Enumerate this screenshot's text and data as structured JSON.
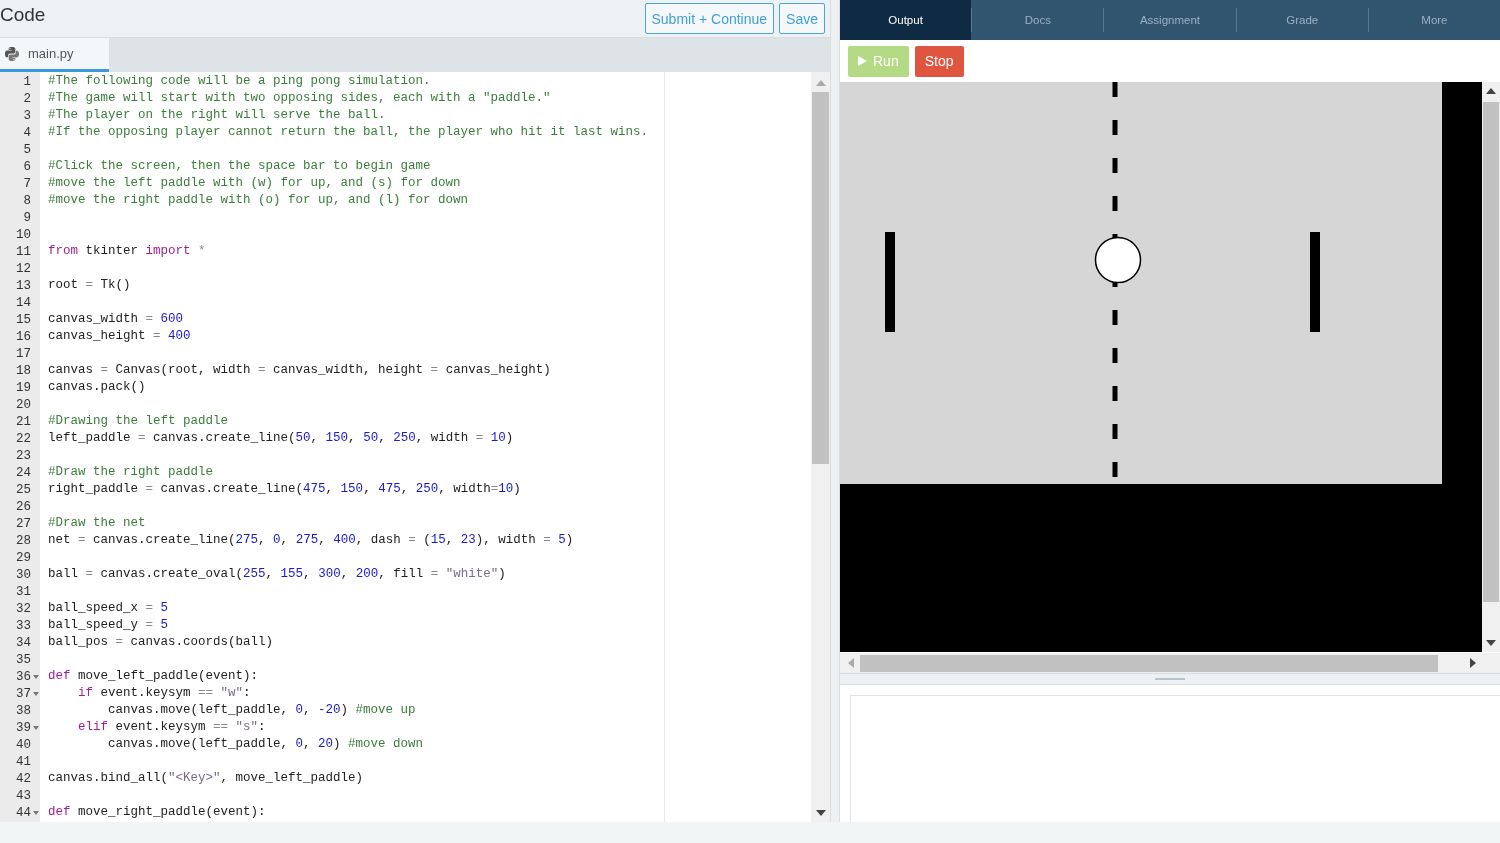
{
  "editor": {
    "title": "Code",
    "buttons": [
      {
        "label": "Submit + Continue"
      },
      {
        "label": "Save"
      }
    ],
    "file_tabs": [
      {
        "label": "main.py",
        "selected": true
      }
    ],
    "lines": [
      {
        "number": "1",
        "fold": false,
        "tokens": [
          {
            "kind": "comment",
            "text": "#The following code will be a ping pong simulation."
          }
        ]
      },
      {
        "number": "2",
        "fold": false,
        "tokens": [
          {
            "kind": "comment",
            "text": "#The game will start with two opposing sides, each with a \"paddle.\""
          }
        ]
      },
      {
        "number": "3",
        "fold": false,
        "tokens": [
          {
            "kind": "comment",
            "text": "#The player on the right will serve the ball."
          }
        ]
      },
      {
        "number": "4",
        "fold": false,
        "tokens": [
          {
            "kind": "comment",
            "text": "#If the opposing player cannot return the ball, the player who hit it last wins."
          }
        ]
      },
      {
        "number": "5",
        "fold": false
      },
      {
        "number": "6",
        "fold": false,
        "tokens": [
          {
            "kind": "comment",
            "text": "#Click the screen, then the space bar to begin game"
          }
        ]
      },
      {
        "number": "7",
        "fold": false,
        "tokens": [
          {
            "kind": "comment",
            "text": "#move the left paddle with (w) for up, and (s) for down"
          }
        ]
      },
      {
        "number": "8",
        "fold": false,
        "tokens": [
          {
            "kind": "comment",
            "text": "#move the right paddle with (o) for up, and (l) for down"
          }
        ]
      },
      {
        "number": "9",
        "fold": false
      },
      {
        "number": "10",
        "fold": false
      },
      {
        "number": "11",
        "fold": false,
        "tokens": [
          {
            "kind": "keyword",
            "text": "from"
          },
          {
            "kind": "plain",
            "text": " tkinter "
          },
          {
            "kind": "keyword",
            "text": "import"
          },
          {
            "kind": "operator",
            "text": " *"
          }
        ]
      },
      {
        "number": "12",
        "fold": false
      },
      {
        "number": "13",
        "fold": false,
        "tokens": [
          {
            "kind": "plain",
            "text": "root "
          },
          {
            "kind": "operator",
            "text": "="
          },
          {
            "kind": "plain",
            "text": " Tk()"
          }
        ]
      },
      {
        "number": "14",
        "fold": false
      },
      {
        "number": "15",
        "fold": false,
        "tokens": [
          {
            "kind": "plain",
            "text": "canvas_width "
          },
          {
            "kind": "operator",
            "text": "= "
          },
          {
            "kind": "number",
            "text": "600"
          }
        ]
      },
      {
        "number": "16",
        "fold": false,
        "tokens": [
          {
            "kind": "plain",
            "text": "canvas_height "
          },
          {
            "kind": "operator",
            "text": "= "
          },
          {
            "kind": "number",
            "text": "400"
          }
        ]
      },
      {
        "number": "17",
        "fold": false
      },
      {
        "number": "18",
        "fold": false,
        "tokens": [
          {
            "kind": "plain",
            "text": "canvas "
          },
          {
            "kind": "operator",
            "text": "="
          },
          {
            "kind": "plain",
            "text": " Canvas(root, width "
          },
          {
            "kind": "operator",
            "text": "="
          },
          {
            "kind": "plain",
            "text": " canvas_width, height "
          },
          {
            "kind": "operator",
            "text": "="
          },
          {
            "kind": "plain",
            "text": " canvas_height)"
          }
        ]
      },
      {
        "number": "19",
        "fold": false,
        "tokens": [
          {
            "kind": "plain",
            "text": "canvas.pack()"
          }
        ]
      },
      {
        "number": "20",
        "fold": false
      },
      {
        "number": "21",
        "fold": false,
        "tokens": [
          {
            "kind": "comment",
            "text": "#Drawing the left paddle"
          }
        ]
      },
      {
        "number": "22",
        "fold": false,
        "tokens": [
          {
            "kind": "plain",
            "text": "left_paddle "
          },
          {
            "kind": "operator",
            "text": "="
          },
          {
            "kind": "plain",
            "text": " canvas.create_line("
          },
          {
            "kind": "number",
            "text": "50"
          },
          {
            "kind": "plain",
            "text": ", "
          },
          {
            "kind": "number",
            "text": "150"
          },
          {
            "kind": "plain",
            "text": ", "
          },
          {
            "kind": "number",
            "text": "50"
          },
          {
            "kind": "plain",
            "text": ", "
          },
          {
            "kind": "number",
            "text": "250"
          },
          {
            "kind": "plain",
            "text": ", width "
          },
          {
            "kind": "operator",
            "text": "= "
          },
          {
            "kind": "number",
            "text": "10"
          },
          {
            "kind": "plain",
            "text": ")"
          }
        ]
      },
      {
        "number": "23",
        "fold": false
      },
      {
        "number": "24",
        "fold": false,
        "tokens": [
          {
            "kind": "comment",
            "text": "#Draw the right paddle"
          }
        ]
      },
      {
        "number": "25",
        "fold": false,
        "tokens": [
          {
            "kind": "plain",
            "text": "right_paddle "
          },
          {
            "kind": "operator",
            "text": "="
          },
          {
            "kind": "plain",
            "text": " canvas.create_line("
          },
          {
            "kind": "number",
            "text": "475"
          },
          {
            "kind": "plain",
            "text": ", "
          },
          {
            "kind": "number",
            "text": "150"
          },
          {
            "kind": "plain",
            "text": ", "
          },
          {
            "kind": "number",
            "text": "475"
          },
          {
            "kind": "plain",
            "text": ", "
          },
          {
            "kind": "number",
            "text": "250"
          },
          {
            "kind": "plain",
            "text": ", width"
          },
          {
            "kind": "operator",
            "text": "="
          },
          {
            "kind": "number",
            "text": "10"
          },
          {
            "kind": "plain",
            "text": ")"
          }
        ]
      },
      {
        "number": "26",
        "fold": false
      },
      {
        "number": "27",
        "fold": false,
        "tokens": [
          {
            "kind": "comment",
            "text": "#Draw the net"
          }
        ]
      },
      {
        "number": "28",
        "fold": false,
        "tokens": [
          {
            "kind": "plain",
            "text": "net "
          },
          {
            "kind": "operator",
            "text": "="
          },
          {
            "kind": "plain",
            "text": " canvas.create_line("
          },
          {
            "kind": "number",
            "text": "275"
          },
          {
            "kind": "plain",
            "text": ", "
          },
          {
            "kind": "number",
            "text": "0"
          },
          {
            "kind": "plain",
            "text": ", "
          },
          {
            "kind": "number",
            "text": "275"
          },
          {
            "kind": "plain",
            "text": ", "
          },
          {
            "kind": "number",
            "text": "400"
          },
          {
            "kind": "plain",
            "text": ", dash "
          },
          {
            "kind": "operator",
            "text": "="
          },
          {
            "kind": "plain",
            "text": " ("
          },
          {
            "kind": "number",
            "text": "15"
          },
          {
            "kind": "plain",
            "text": ", "
          },
          {
            "kind": "number",
            "text": "23"
          },
          {
            "kind": "plain",
            "text": "), width "
          },
          {
            "kind": "operator",
            "text": "= "
          },
          {
            "kind": "number",
            "text": "5"
          },
          {
            "kind": "plain",
            "text": ")"
          }
        ]
      },
      {
        "number": "29",
        "fold": false
      },
      {
        "number": "30",
        "fold": false,
        "tokens": [
          {
            "kind": "plain",
            "text": "ball "
          },
          {
            "kind": "operator",
            "text": "="
          },
          {
            "kind": "plain",
            "text": " canvas.create_oval("
          },
          {
            "kind": "number",
            "text": "255"
          },
          {
            "kind": "plain",
            "text": ", "
          },
          {
            "kind": "number",
            "text": "155"
          },
          {
            "kind": "plain",
            "text": ", "
          },
          {
            "kind": "number",
            "text": "300"
          },
          {
            "kind": "plain",
            "text": ", "
          },
          {
            "kind": "number",
            "text": "200"
          },
          {
            "kind": "plain",
            "text": ", fill "
          },
          {
            "kind": "operator",
            "text": "= "
          },
          {
            "kind": "string",
            "text": "\"white\""
          },
          {
            "kind": "plain",
            "text": ")"
          }
        ]
      },
      {
        "number": "31",
        "fold": false
      },
      {
        "number": "32",
        "fold": false,
        "tokens": [
          {
            "kind": "plain",
            "text": "ball_speed_x "
          },
          {
            "kind": "operator",
            "text": "= "
          },
          {
            "kind": "number",
            "text": "5"
          }
        ]
      },
      {
        "number": "33",
        "fold": false,
        "tokens": [
          {
            "kind": "plain",
            "text": "ball_speed_y "
          },
          {
            "kind": "operator",
            "text": "= "
          },
          {
            "kind": "number",
            "text": "5"
          }
        ]
      },
      {
        "number": "34",
        "fold": false,
        "tokens": [
          {
            "kind": "plain",
            "text": "ball_pos "
          },
          {
            "kind": "operator",
            "text": "="
          },
          {
            "kind": "plain",
            "text": " canvas.coords(ball)"
          }
        ]
      },
      {
        "number": "35",
        "fold": false
      },
      {
        "number": "36",
        "fold": true,
        "tokens": [
          {
            "kind": "keyword",
            "text": "def"
          },
          {
            "kind": "plain",
            "text": " move_left_paddle(event):"
          }
        ]
      },
      {
        "number": "37",
        "fold": true,
        "tokens": [
          {
            "kind": "keyword",
            "text": "    if"
          },
          {
            "kind": "plain",
            "text": " event.keysym "
          },
          {
            "kind": "operator",
            "text": "== "
          },
          {
            "kind": "string",
            "text": "\"w\""
          },
          {
            "kind": "plain",
            "text": ":"
          }
        ]
      },
      {
        "number": "38",
        "fold": false,
        "tokens": [
          {
            "kind": "plain",
            "text": "        canvas.move(left_paddle, "
          },
          {
            "kind": "number",
            "text": "0"
          },
          {
            "kind": "plain",
            "text": ", "
          },
          {
            "kind": "number",
            "text": "-20"
          },
          {
            "kind": "plain",
            "text": ") "
          },
          {
            "kind": "comment",
            "text": "#move up"
          }
        ]
      },
      {
        "number": "39",
        "fold": true,
        "tokens": [
          {
            "kind": "keyword",
            "text": "    elif"
          },
          {
            "kind": "plain",
            "text": " event.keysym "
          },
          {
            "kind": "operator",
            "text": "== "
          },
          {
            "kind": "string",
            "text": "\"s\""
          },
          {
            "kind": "plain",
            "text": ":"
          }
        ]
      },
      {
        "number": "40",
        "fold": false,
        "tokens": [
          {
            "kind": "plain",
            "text": "        canvas.move(left_paddle, "
          },
          {
            "kind": "number",
            "text": "0"
          },
          {
            "kind": "plain",
            "text": ", "
          },
          {
            "kind": "number",
            "text": "20"
          },
          {
            "kind": "plain",
            "text": ") "
          },
          {
            "kind": "comment",
            "text": "#move down"
          }
        ]
      },
      {
        "number": "41",
        "fold": false
      },
      {
        "number": "42",
        "fold": false,
        "tokens": [
          {
            "kind": "plain",
            "text": "canvas.bind_all("
          },
          {
            "kind": "string",
            "text": "\"<Key>\""
          },
          {
            "kind": "plain",
            "text": ", move_left_paddle)"
          }
        ]
      },
      {
        "number": "43",
        "fold": false
      },
      {
        "number": "44",
        "fold": true,
        "tokens": [
          {
            "kind": "keyword",
            "text": "def"
          },
          {
            "kind": "plain",
            "text": " move_right_paddle(event):"
          }
        ]
      }
    ]
  },
  "output": {
    "tabs": [
      {
        "label": "Output",
        "selected": true
      },
      {
        "label": "Docs",
        "selected": false
      },
      {
        "label": "Assignment",
        "selected": false
      },
      {
        "label": "Grade",
        "selected": false
      },
      {
        "label": "More",
        "selected": false
      }
    ],
    "controls": [
      {
        "kind": "run",
        "label": "Run",
        "disabled": true
      },
      {
        "kind": "stop",
        "label": "Stop",
        "disabled": false
      }
    ]
  }
}
